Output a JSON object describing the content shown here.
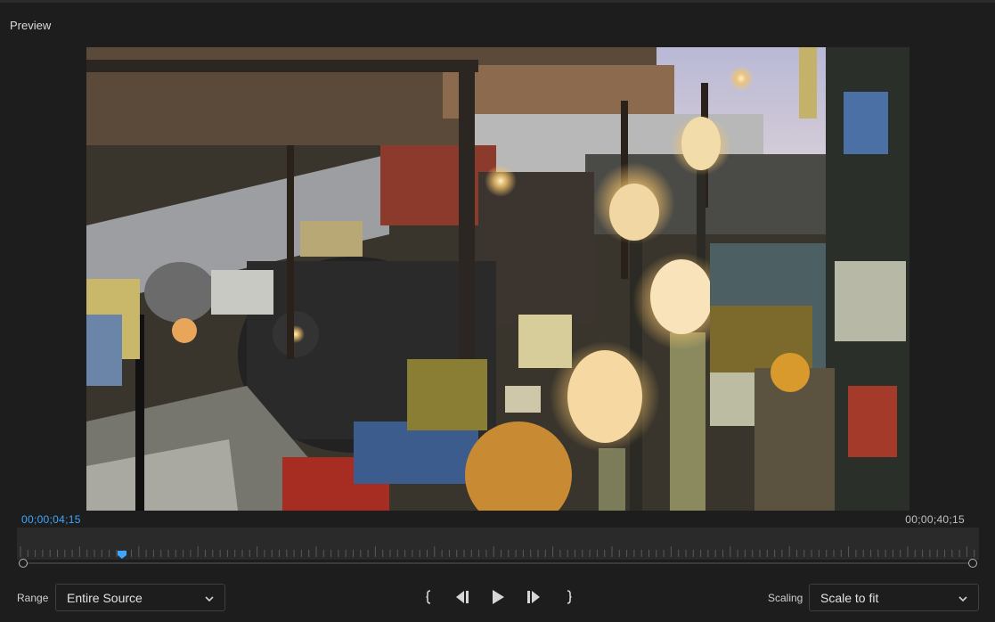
{
  "panel": {
    "title": "Preview"
  },
  "preview": {
    "content": "video frame"
  },
  "timecodes": {
    "current": "00;00;04;15",
    "duration": "00;00;40;15"
  },
  "playhead": {
    "position_fraction": 0.109
  },
  "range": {
    "label": "Range",
    "selected": "Entire Source"
  },
  "scaling": {
    "label": "Scaling",
    "selected": "Scale to fit"
  },
  "controls": {
    "mark_in": "mark-in-icon",
    "step_back": "step-back-icon",
    "play": "play-icon",
    "step_forward": "step-forward-icon",
    "mark_out": "mark-out-icon"
  },
  "colors": {
    "accent": "#3ea6ff",
    "background": "#1d1d1d",
    "timeline": "#2a2a2a"
  }
}
